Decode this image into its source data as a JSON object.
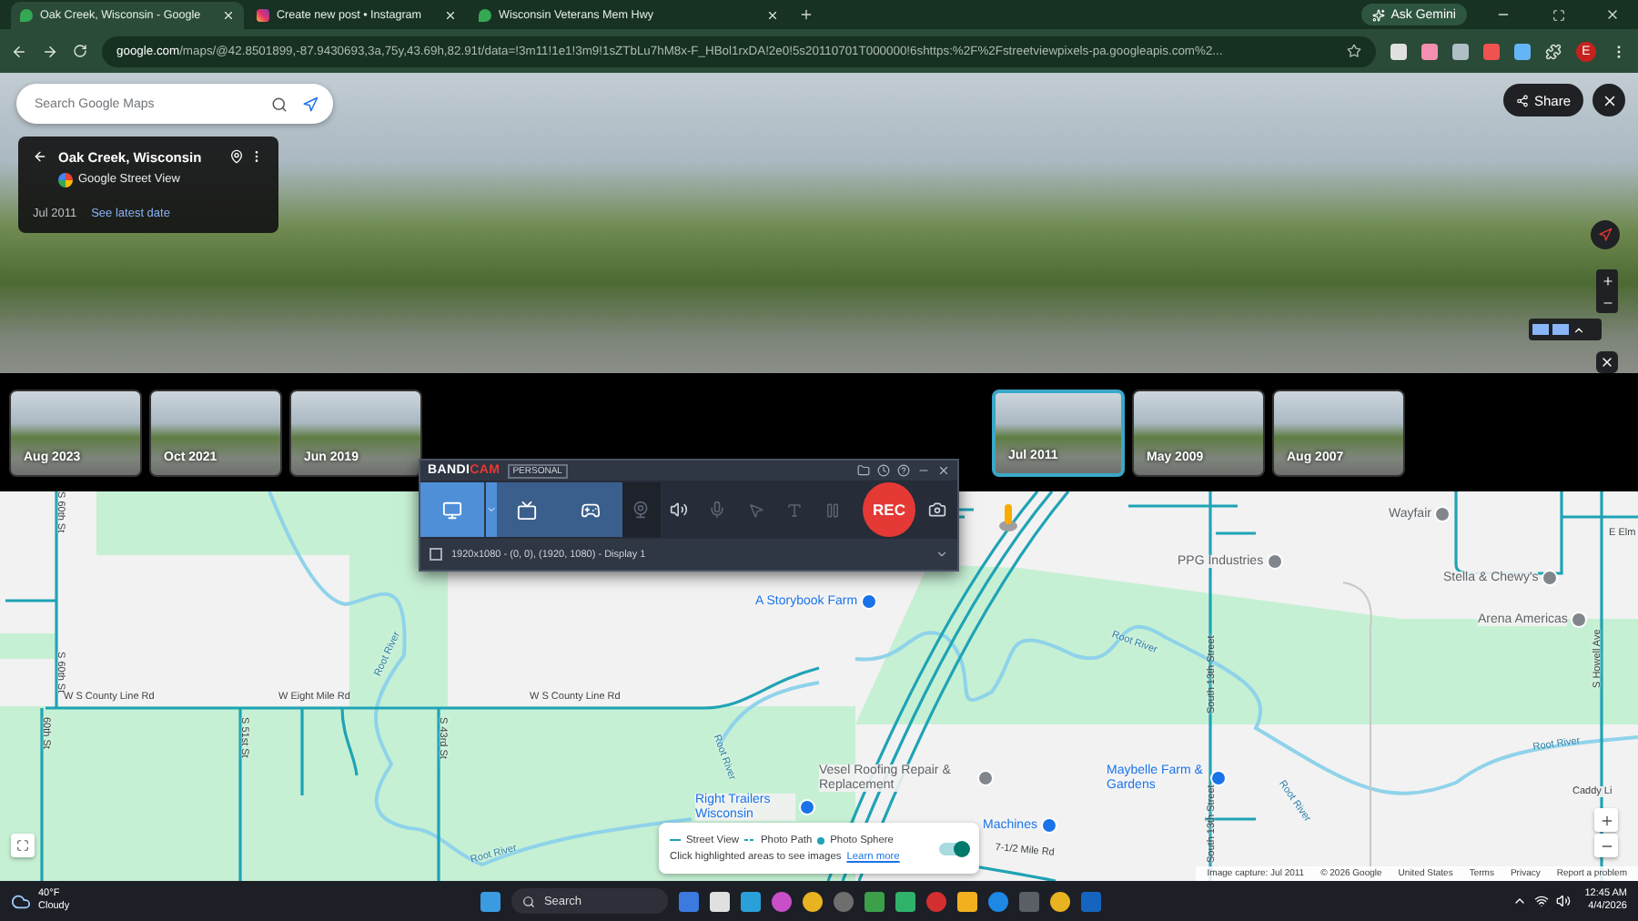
{
  "browser": {
    "tabs": [
      {
        "title": "Oak Creek, Wisconsin - Google",
        "selected": true
      },
      {
        "title": "Create new post • Instagram",
        "selected": false
      },
      {
        "title": "Wisconsin Veterans Mem Hwy",
        "selected": false
      }
    ],
    "gemini_button": "Ask Gemini",
    "url_host": "google.com",
    "url_path": "/maps/@42.8501899,-87.9430693,3a,75y,43.69h,82.91t/data=!3m11!1e1!3m9!1sZTbLu7hM8x-F_HBol1rxDA!2e0!5s20110701T000000!6shttps:%2F%2Fstreetviewpixels-pa.googleapis.com%2...",
    "profile_initial": "E"
  },
  "street_view": {
    "search_placeholder": "Search Google Maps",
    "place_title": "Oak Creek, Wisconsin",
    "source": "Google Street View",
    "capture_date": "Jul 2011",
    "latest_link": "See latest date",
    "share_button": "Share"
  },
  "timeline": [
    {
      "label": "Aug 2023",
      "selected": false
    },
    {
      "label": "Oct 2021",
      "selected": false
    },
    {
      "label": "Jun 2019",
      "selected": false
    },
    {
      "label": "Jul 2011",
      "selected": true
    },
    {
      "label": "May 2009",
      "selected": false
    },
    {
      "label": "Aug 2007",
      "selected": false
    }
  ],
  "recorder": {
    "logo_main": "BANDI",
    "logo_accent": "CAM",
    "edition": "PERSONAL",
    "modes": [
      {
        "kind": "screen",
        "selected": true
      },
      {
        "kind": "device",
        "selected": false
      },
      {
        "kind": "game",
        "selected": false
      }
    ],
    "rec_button": "REC",
    "area_checked": false,
    "status": "1920x1080 - (0, 0), (1920, 1080) - Display 1"
  },
  "map": {
    "labels": [
      {
        "text": "S 60th St",
        "kind": "road"
      },
      {
        "text": "S 60th St",
        "kind": "road"
      },
      {
        "text": "W S County Line Rd",
        "kind": "road"
      },
      {
        "text": "W Eight Mile Rd",
        "kind": "road"
      },
      {
        "text": "W S County Line Rd",
        "kind": "road"
      },
      {
        "text": "60th St",
        "kind": "road"
      },
      {
        "text": "S 51st St",
        "kind": "road"
      },
      {
        "text": "S 43rd St",
        "kind": "road"
      },
      {
        "text": "Root River",
        "kind": "river"
      },
      {
        "text": "Root River",
        "kind": "river"
      },
      {
        "text": "A Storybook Farm",
        "kind": "place"
      },
      {
        "text": "Right Trailers Wisconsin",
        "kind": "place"
      },
      {
        "text": "Vesel Roofing Repair & Replacement",
        "kind": "business"
      },
      {
        "text": "Wayfair",
        "kind": "business"
      },
      {
        "text": "PPG Industries",
        "kind": "business"
      },
      {
        "text": "Stella & Chewy's",
        "kind": "business"
      },
      {
        "text": "Arena Americas",
        "kind": "business"
      },
      {
        "text": "Root River",
        "kind": "river"
      },
      {
        "text": "South 13th Street",
        "kind": "road"
      },
      {
        "text": "South 13th Street",
        "kind": "road"
      },
      {
        "text": "S Howell Ave",
        "kind": "road"
      },
      {
        "text": "Root River",
        "kind": "river"
      },
      {
        "text": "Root River",
        "kind": "river"
      },
      {
        "text": "Maybelle Farm & Gardens",
        "kind": "place"
      },
      {
        "text": "Machines",
        "kind": "place"
      },
      {
        "text": "7-1/2 Mile Rd",
        "kind": "road"
      },
      {
        "text": "E Elm",
        "kind": "road"
      },
      {
        "text": "Caddy Li",
        "kind": "road"
      },
      {
        "text": "Root River",
        "kind": "river"
      }
    ],
    "legend": {
      "items": [
        "Street View",
        "Photo Path",
        "Photo Sphere"
      ],
      "hint": "Click highlighted areas to see images",
      "link": "Learn more",
      "toggle_on": true
    },
    "footer": [
      "Image capture: Jul 2011",
      "© 2026 Google",
      "United States",
      "Terms",
      "Privacy",
      "Report a problem"
    ]
  },
  "taskbar": {
    "temperature": "40°F",
    "weather": "Cloudy",
    "search": "Search",
    "time": "12:45 AM",
    "date": "4/4/2026"
  }
}
